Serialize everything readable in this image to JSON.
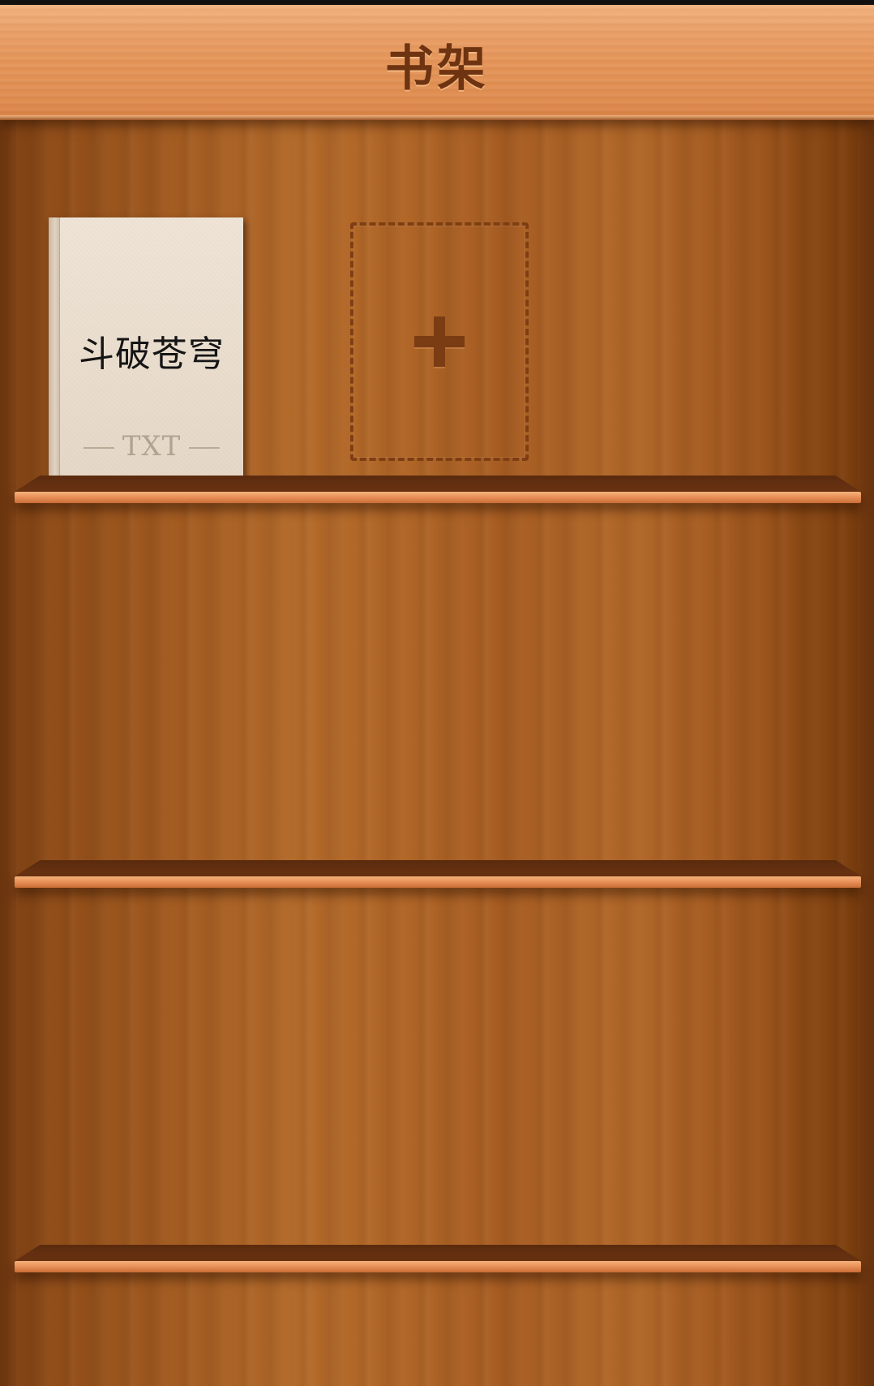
{
  "header": {
    "title": "书架"
  },
  "bookshelf": {
    "books": [
      {
        "title": "斗破苍穹",
        "format": "TXT"
      }
    ],
    "add_slot": {
      "icon": "plus-icon"
    },
    "shelf_count": 3
  },
  "colors": {
    "header_background": "#e59457",
    "header_text": "#6e3310",
    "wood": "#a75d22",
    "shelf_edge": "#e9925a",
    "book_cover": "#e6d7c6"
  }
}
